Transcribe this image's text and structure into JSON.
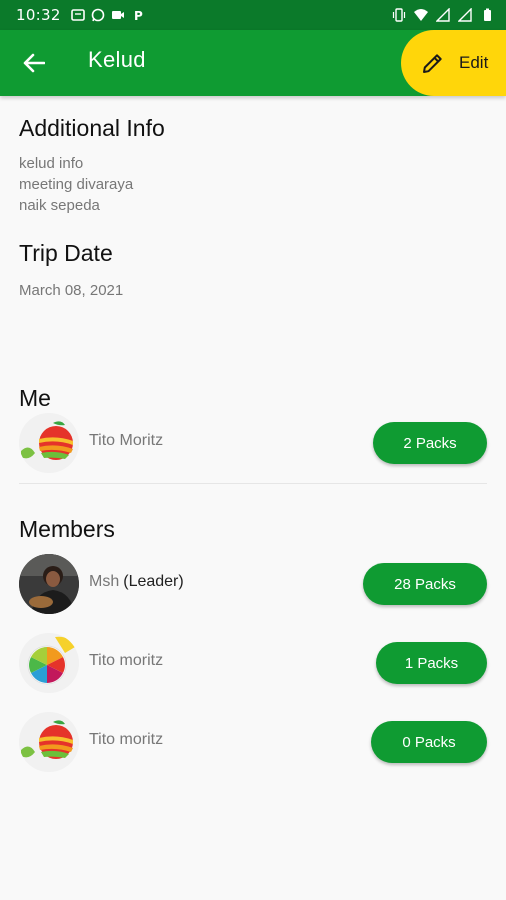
{
  "status_bar": {
    "time": "10:32",
    "icons": [
      "message-icon",
      "whatsapp-icon",
      "video-icon",
      "p-icon"
    ],
    "right_icons": [
      "vibrate-icon",
      "wifi-icon",
      "signal-icon",
      "signal-icon",
      "battery-icon"
    ]
  },
  "app_bar": {
    "title": "Kelud",
    "edit_label": "Edit"
  },
  "additional_info": {
    "title": "Additional Info",
    "lines": [
      "kelud info",
      "meeting divaraya",
      "naik sepeda"
    ]
  },
  "trip_date": {
    "title": "Trip Date",
    "value": "March 08, 2021"
  },
  "me": {
    "title": "Me",
    "name": "Tito Moritz",
    "packs": "2 Packs"
  },
  "members": {
    "title": "Members",
    "items": [
      {
        "name": "Msh",
        "tag": "(Leader)",
        "packs": "28 Packs"
      },
      {
        "name": "Tito moritz",
        "tag": "",
        "packs": "1 Packs"
      },
      {
        "name": "Tito moritz",
        "tag": "",
        "packs": "0 Packs"
      }
    ]
  },
  "colors": {
    "status_bar": "#0b7a2a",
    "app_bar": "#0f9b32",
    "edit_button": "#ffd60a",
    "packs_button": "#0f9b32"
  }
}
